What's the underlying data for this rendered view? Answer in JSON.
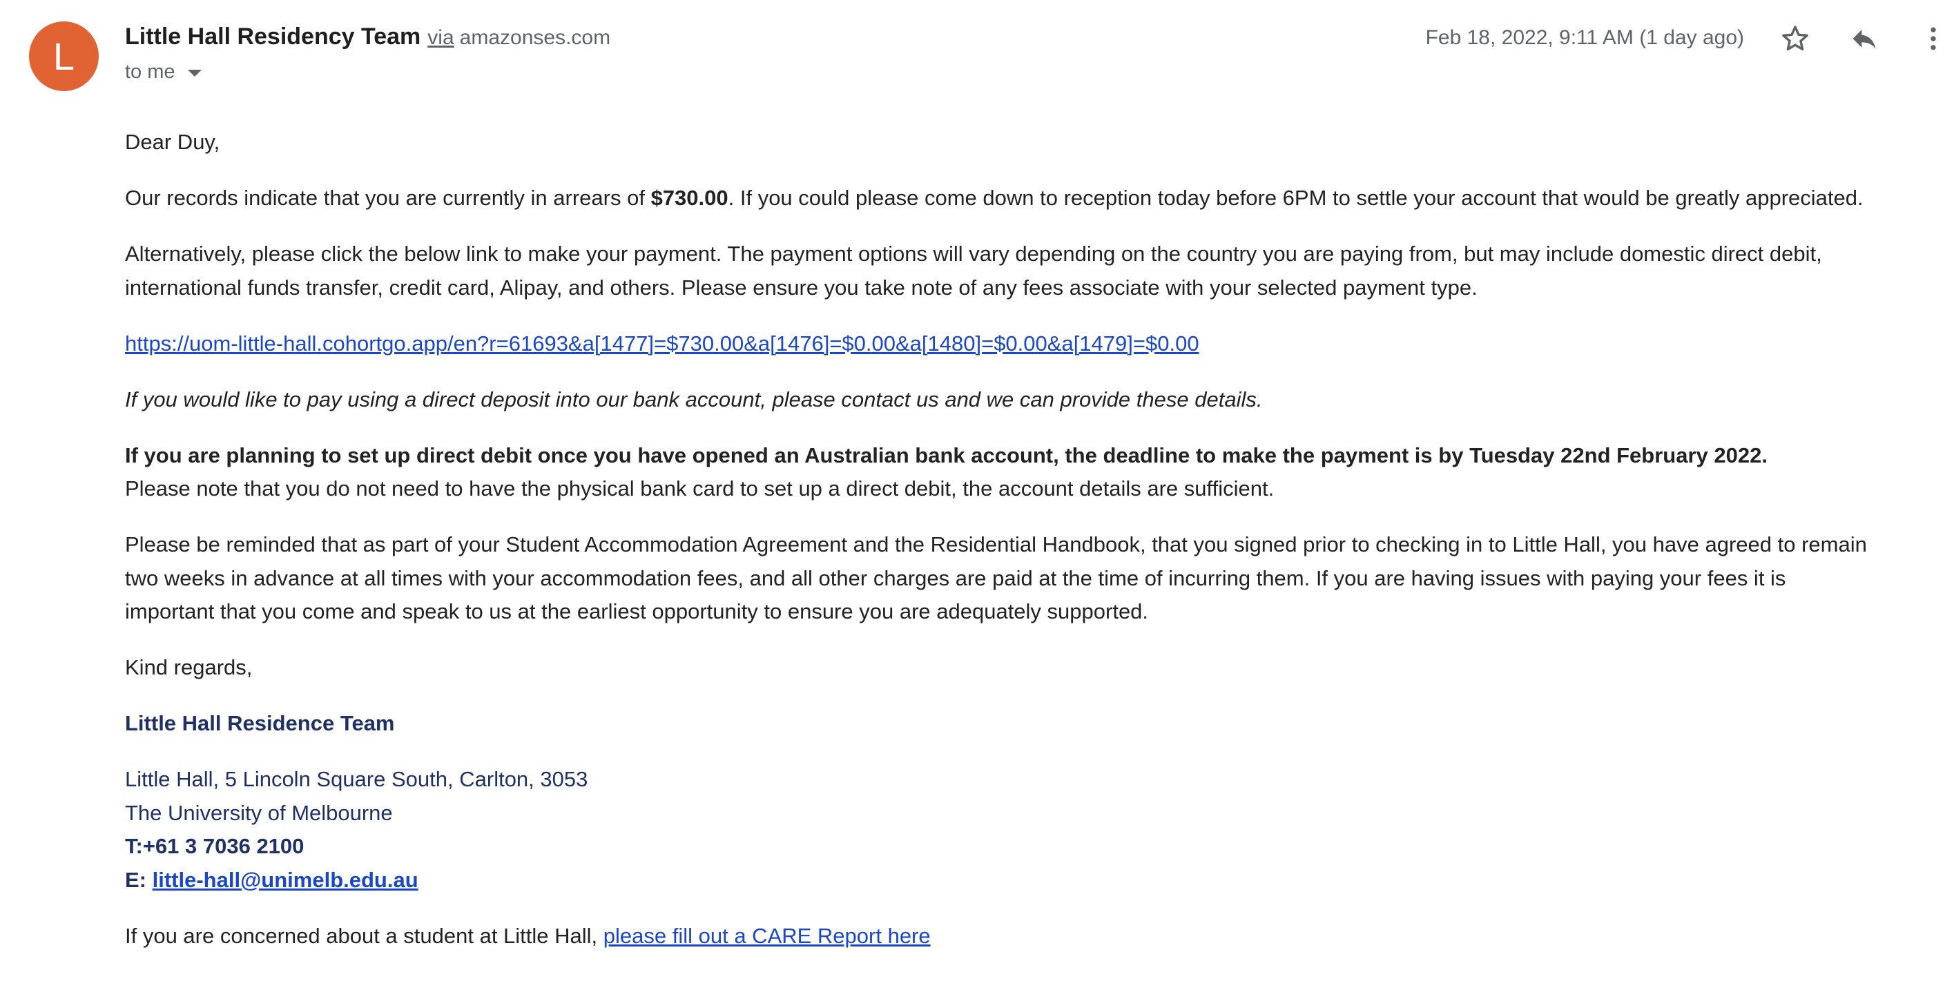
{
  "header": {
    "avatar_letter": "L",
    "avatar_color": "#e16232",
    "sender_name": "Little Hall Residency Team",
    "via_label": "via",
    "via_domain": "amazonses.com",
    "to_label": "to me",
    "date": "Feb 18, 2022, 9:11 AM (1 day ago)",
    "icons": [
      "star-icon",
      "reply-icon",
      "more-vert-icon"
    ]
  },
  "email": {
    "greeting": "Dear Duy,",
    "p1_before": "Our records indicate that you are currently in arrears of ",
    "p1_amount": "$730.00",
    "p1_after": ". If you could please come down to reception today before 6PM to settle your account that would be greatly appreciated.",
    "p2_line1": "Alternatively, please click the below link to make your payment. The payment options will vary depending on the country you are paying from, but may include domestic direct debit,",
    "p2_line2": "international funds transfer, credit card, Alipay, and others. Please ensure you take note of any fees associate with your selected payment type.",
    "payment_link": "https://uom-little-hall.cohortgo.app/en?r=61693&a[1477]=$730.00&a[1476]=$0.00&a[1480]=$0.00&a[1479]=$0.00",
    "p3_italic": "If you would like to pay using a direct deposit into our bank account, please contact us and we can provide these details.",
    "p4_bold": "If you are planning to set up direct debit once you have opened an Australian bank account, the deadline to make the payment is by Tuesday 22nd February 2022.",
    "p4_line2": "Please note that you do not need to have the physical bank card to set up a direct debit, the account details are sufficient.",
    "p5_line1": "Please be reminded that as part of your Student Accommodation Agreement and the Residential Handbook, that you signed prior to checking in to Little Hall, you have agreed to remain",
    "p5_line2": "two weeks in advance at all times with your accommodation fees, and all other charges are paid at the time of incurring them. If you are having issues with paying your fees it is",
    "p5_line3": "important that you come and speak to us at the earliest opportunity to ensure you are adequately supported.",
    "closing": "Kind regards,",
    "signature_name": "Little Hall Residence Team",
    "address": "Little Hall, 5 Lincoln Square South, Carlton, 3053",
    "university": "The University of Melbourne",
    "phone": "T:+61 3 7036 2100",
    "email_prefix": "E: ",
    "email_address": "little-hall@unimelb.edu.au ",
    "care_text": "If you are concerned about a student at Little Hall, ",
    "care_link": "please fill out a CARE Report here"
  }
}
